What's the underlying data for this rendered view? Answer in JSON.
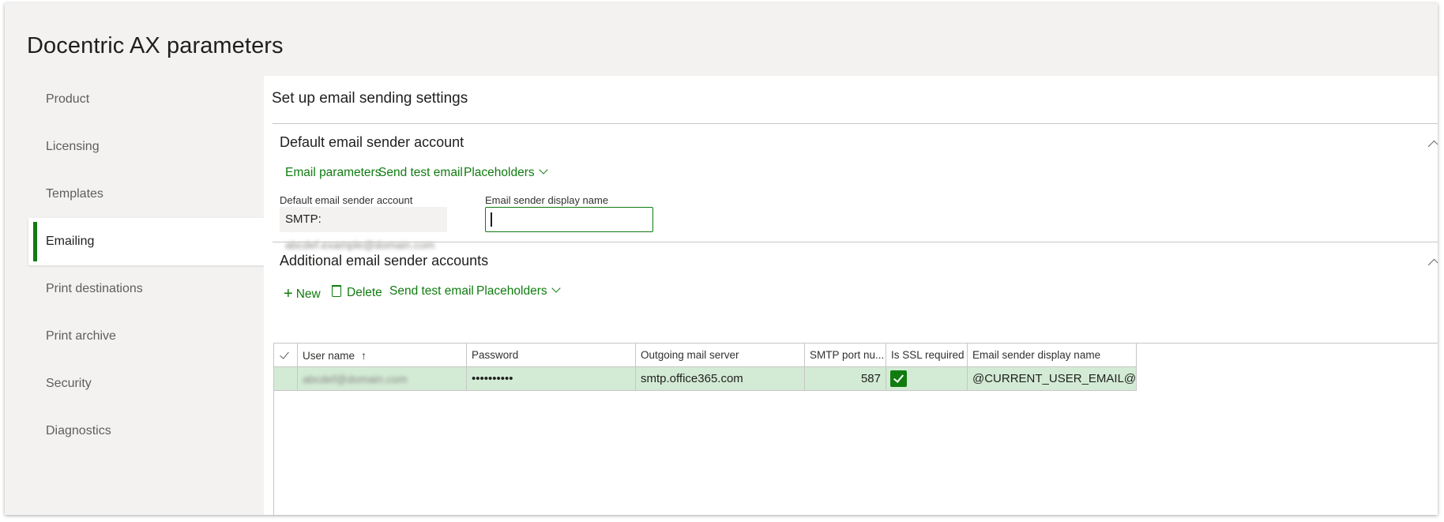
{
  "page": {
    "title": "Docentric AX parameters"
  },
  "nav": {
    "items": [
      {
        "label": "Product"
      },
      {
        "label": "Licensing"
      },
      {
        "label": "Templates"
      },
      {
        "label": "Emailing",
        "active": true
      },
      {
        "label": "Print destinations"
      },
      {
        "label": "Print archive"
      },
      {
        "label": "Security"
      },
      {
        "label": "Diagnostics"
      }
    ]
  },
  "main": {
    "heading": "Set up email sending settings",
    "default_section": {
      "title": "Default email sender account",
      "actions": {
        "email_parameters": "Email parameters",
        "send_test_email": "Send test email",
        "placeholders": "Placeholders"
      },
      "fields": {
        "sender_account_label": "Default email sender account",
        "sender_account_prefix": "SMTP:",
        "sender_account_value": "abcdef.example@domain.com",
        "display_name_label": "Email sender display name",
        "display_name_value": ""
      }
    },
    "additional_section": {
      "title": "Additional email sender accounts",
      "actions": {
        "new": "New",
        "delete": "Delete",
        "send_test_email": "Send test email",
        "placeholders": "Placeholders"
      },
      "grid": {
        "headers": [
          "User name",
          "Password",
          "Outgoing mail server",
          "SMTP port nu...",
          "Is SSL required",
          "Email sender display name"
        ],
        "rows": [
          {
            "user_name": "abcdef@domain.com",
            "password": "••••••••••",
            "server": "smtp.office365.com",
            "port": "587",
            "ssl": true,
            "display_name": "@CURRENT_USER_EMAIL@"
          }
        ]
      }
    }
  },
  "colors": {
    "accent": "#107c10",
    "selected_row": "#d3ebd5",
    "nav_bg": "#f3f2f1"
  }
}
